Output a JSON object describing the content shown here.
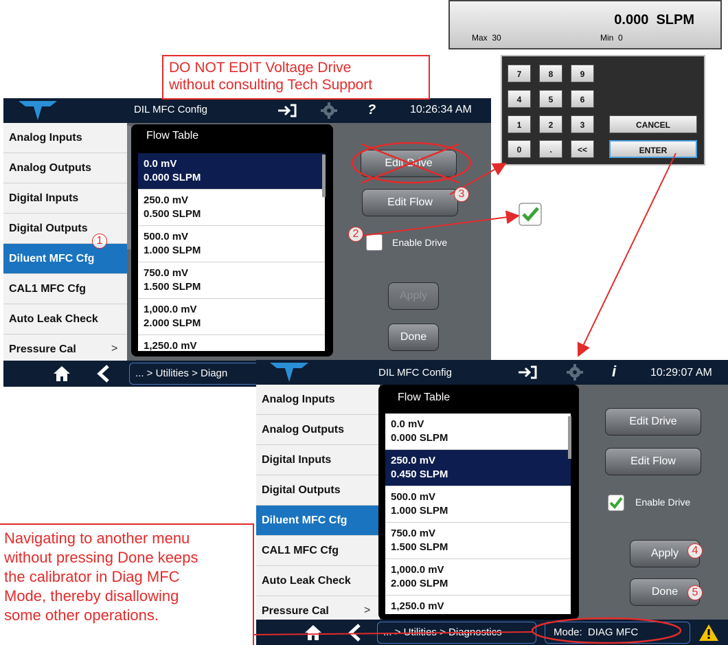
{
  "colors": {
    "accent": "#1a74c0",
    "annotation": "#e32b2b",
    "topbar": "#0d1d33",
    "panel_bg": "#5f6469"
  },
  "top_display": {
    "value": "0.000  SLPM",
    "max_label": "Max  30",
    "min_label": "Min  0"
  },
  "keypad": {
    "keys": [
      "7",
      "8",
      "9",
      "4",
      "5",
      "6",
      "1",
      "2",
      "3",
      "0",
      ".",
      "<<"
    ],
    "cancel": "CANCEL",
    "enter": "ENTER"
  },
  "notes": {
    "warning_line1": "DO NOT EDIT Voltage Drive",
    "warning_line2": "without consulting Tech Support",
    "nav_note": [
      "Navigating to another menu",
      "without pressing Done keeps",
      "the calibrator in Diag MFC",
      "Mode, thereby disallowing",
      "some other operations."
    ]
  },
  "steps": [
    "1",
    "2",
    "3",
    "4",
    "5"
  ],
  "screen1": {
    "title": "DIL MFC Config",
    "time": "10:26:34 AM",
    "info_glyph": "?",
    "sidebar": [
      "Analog Inputs",
      "Analog Outputs",
      "Digital Inputs",
      "Digital Outputs",
      "Diluent MFC Cfg",
      "CAL1 MFC Cfg",
      "Auto Leak Check",
      "Pressure Cal"
    ],
    "sidebar_more": ">",
    "flow_title": "Flow Table",
    "rows": [
      [
        "0.0 mV",
        "0.000 SLPM"
      ],
      [
        "250.0 mV",
        "0.500 SLPM"
      ],
      [
        "500.0 mV",
        "1.000 SLPM"
      ],
      [
        "750.0 mV",
        "1.500 SLPM"
      ],
      [
        "1,000.0 mV",
        "2.000 SLPM"
      ],
      [
        "1,250.0 mV",
        ""
      ]
    ],
    "edit_drive": "Edit Drive",
    "edit_flow": "Edit Flow",
    "enable_drive": "Enable Drive",
    "apply": "Apply",
    "done": "Done",
    "breadcrumb": "... > Utilities > Diagn"
  },
  "screen2": {
    "title": "DIL MFC Config",
    "time": "10:29:07 AM",
    "info_glyph": "i",
    "sidebar": [
      "Analog Inputs",
      "Analog Outputs",
      "Digital Inputs",
      "Digital Outputs",
      "Diluent MFC Cfg",
      "CAL1 MFC Cfg",
      "Auto Leak Check",
      "Pressure Cal"
    ],
    "sidebar_more": ">",
    "flow_title": "Flow Table",
    "rows": [
      [
        "0.0 mV",
        "0.000 SLPM"
      ],
      [
        "250.0 mV",
        "0.450 SLPM"
      ],
      [
        "500.0 mV",
        "1.000 SLPM"
      ],
      [
        "750.0 mV",
        "1.500 SLPM"
      ],
      [
        "1,000.0 mV",
        "2.000 SLPM"
      ],
      [
        "1,250.0 mV",
        ""
      ]
    ],
    "edit_drive": "Edit Drive",
    "edit_flow": "Edit Flow",
    "enable_drive": "Enable Drive",
    "apply": "Apply",
    "done": "Done",
    "breadcrumb": "... > Utilities > Diagnostics",
    "mode_label": "Mode:",
    "mode_value": "DIAG MFC"
  }
}
